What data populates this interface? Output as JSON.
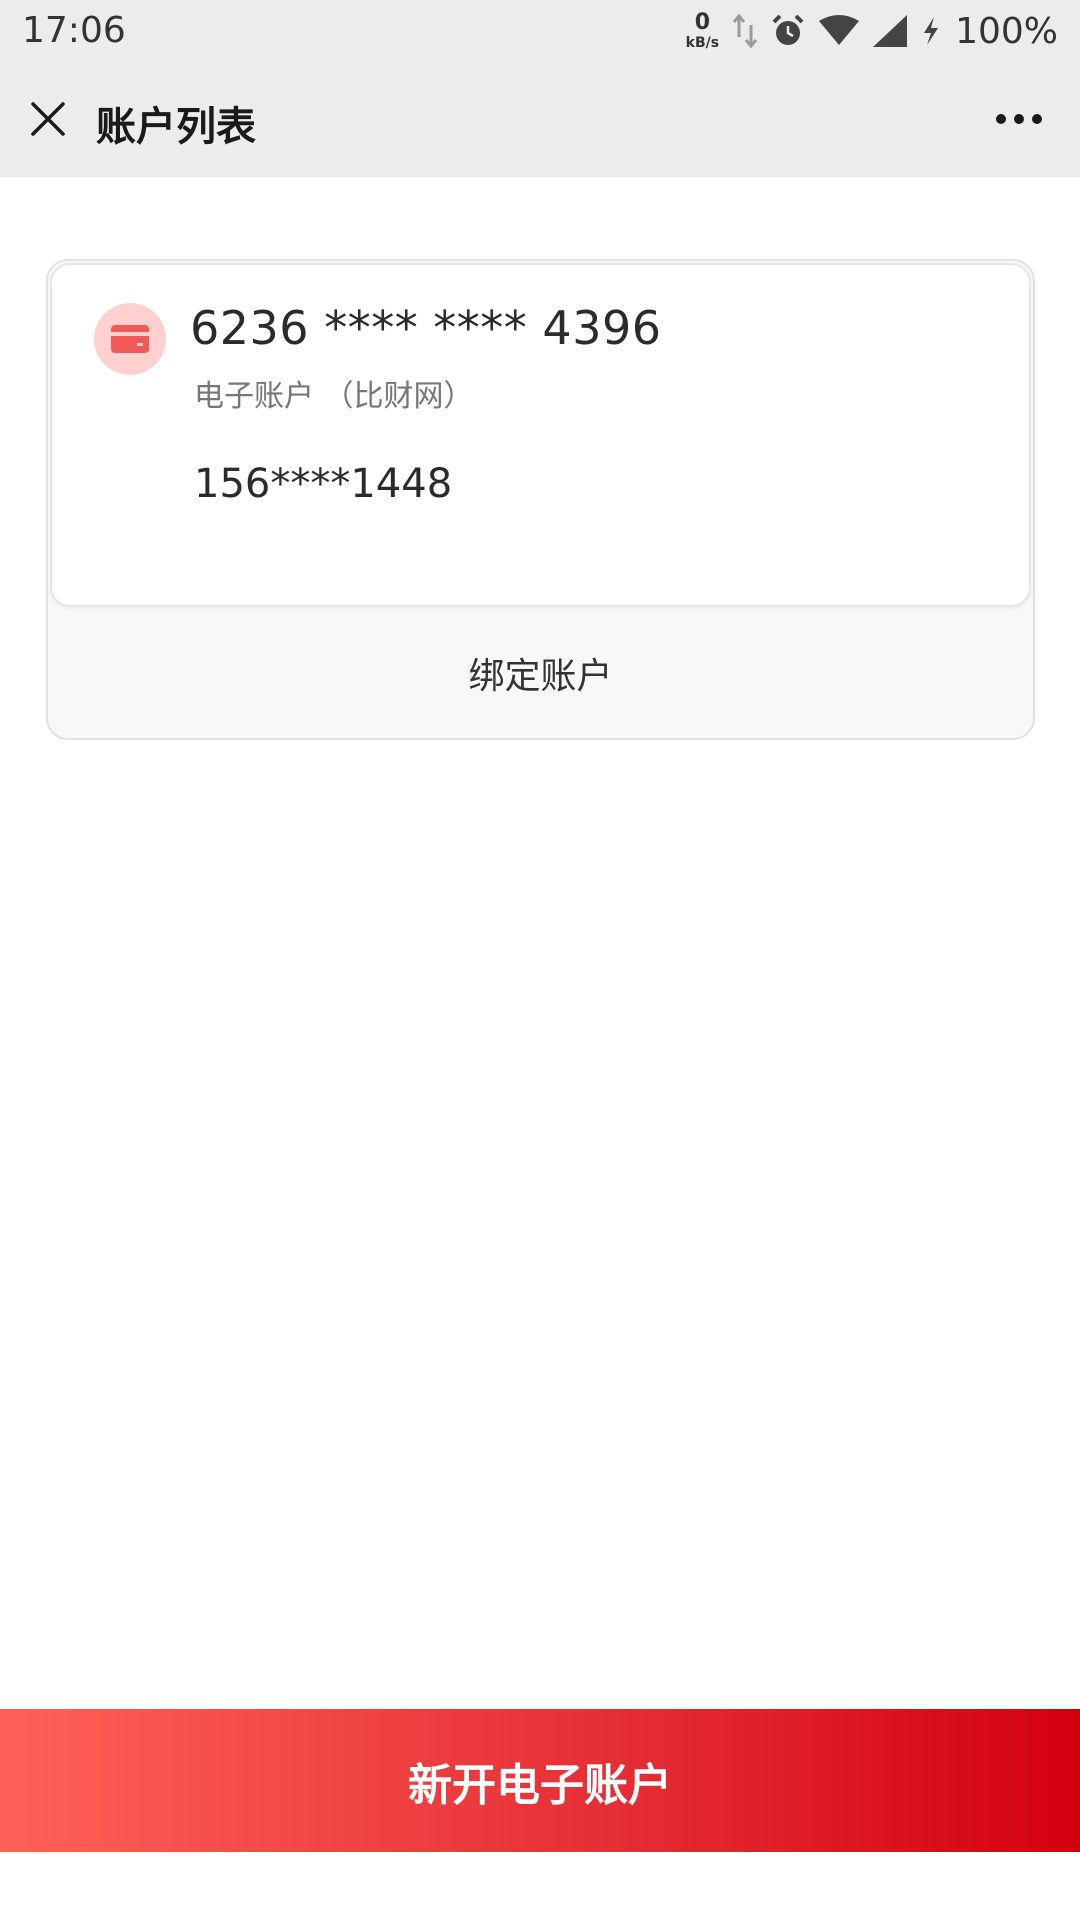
{
  "status_bar": {
    "time": "17:06",
    "net_speed_value": "0",
    "net_speed_unit": "kB/s",
    "battery": "100%",
    "icons": [
      "data-arrows-icon",
      "alarm-icon",
      "wifi-icon",
      "signal-icon",
      "charging-icon"
    ]
  },
  "app_bar": {
    "title": "账户列表",
    "close_icon": "close-icon",
    "more_icon": "more-icon"
  },
  "account": {
    "icon": "credit-card-icon",
    "card_number": "6236 **** **** 4396",
    "type": "电子账户 （比财网）",
    "phone": "156****1448",
    "bind_label": "绑定账户"
  },
  "bottom": {
    "open_account_label": "新开电子账户"
  },
  "colors": {
    "accent_start": "#ff6158",
    "accent_end": "#d4000f",
    "card_icon_bg": "#ffd0d0",
    "card_icon": "#f25a5a"
  }
}
